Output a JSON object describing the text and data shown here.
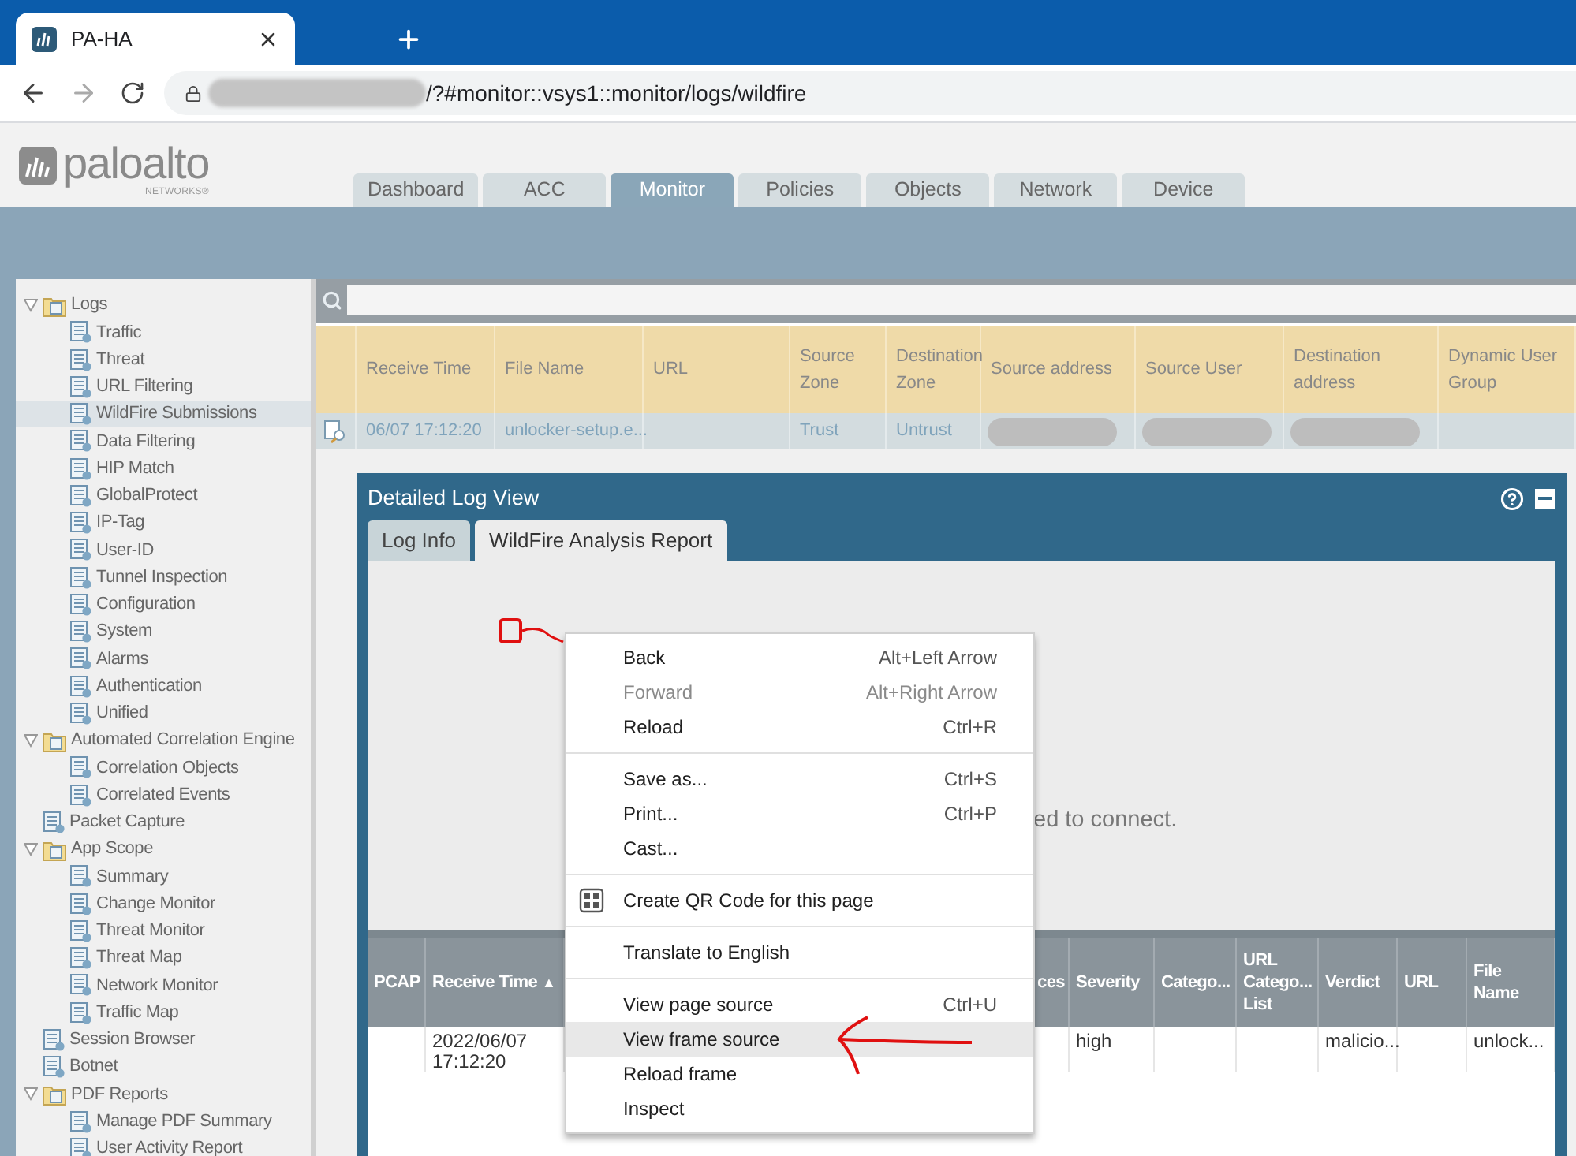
{
  "browser": {
    "tab": {
      "title": "PA-HA"
    },
    "address": {
      "url": "/?#monitor::vsys1::monitor/logs/wildfire",
      "redacted": true
    }
  },
  "header": {
    "logo": "paloalto",
    "logo_sub": "NETWORKS®",
    "tabs": [
      {
        "label": "Dashboard",
        "selected": false
      },
      {
        "label": "ACC",
        "selected": false
      },
      {
        "label": "Monitor",
        "selected": true
      },
      {
        "label": "Policies",
        "selected": false
      },
      {
        "label": "Objects",
        "selected": false
      },
      {
        "label": "Network",
        "selected": false
      },
      {
        "label": "Device",
        "selected": false
      }
    ]
  },
  "sidebar": {
    "items": [
      {
        "label": "Logs",
        "selected": false,
        "expanded": true,
        "children": [
          {
            "label": "Traffic",
            "selected": false
          },
          {
            "label": "Threat",
            "selected": false
          },
          {
            "label": "URL Filtering",
            "selected": false
          },
          {
            "label": "WildFire Submissions",
            "selected": true
          },
          {
            "label": "Data Filtering",
            "selected": false
          },
          {
            "label": "HIP Match",
            "selected": false
          },
          {
            "label": "GlobalProtect",
            "selected": false
          },
          {
            "label": "IP-Tag",
            "selected": false
          },
          {
            "label": "User-ID",
            "selected": false
          },
          {
            "label": "Tunnel Inspection",
            "selected": false
          },
          {
            "label": "Configuration",
            "selected": false
          },
          {
            "label": "System",
            "selected": false
          },
          {
            "label": "Alarms",
            "selected": false
          },
          {
            "label": "Authentication",
            "selected": false
          },
          {
            "label": "Unified",
            "selected": false
          }
        ]
      },
      {
        "label": "Automated Correlation Engine",
        "selected": false,
        "expanded": true,
        "children": [
          {
            "label": "Correlation Objects",
            "selected": false
          },
          {
            "label": "Correlated Events",
            "selected": false
          }
        ]
      },
      {
        "label": "Packet Capture",
        "selected": false
      },
      {
        "label": "App Scope",
        "selected": false,
        "expanded": true,
        "children": [
          {
            "label": "Summary",
            "selected": false
          },
          {
            "label": "Change Monitor",
            "selected": false
          },
          {
            "label": "Threat Monitor",
            "selected": false
          },
          {
            "label": "Threat Map",
            "selected": false
          },
          {
            "label": "Network Monitor",
            "selected": false
          },
          {
            "label": "Traffic Map",
            "selected": false
          }
        ]
      },
      {
        "label": "Session Browser",
        "selected": false
      },
      {
        "label": "Botnet",
        "selected": false
      },
      {
        "label": "PDF Reports",
        "selected": false,
        "expanded": true,
        "children": [
          {
            "label": "Manage PDF Summary",
            "selected": false
          },
          {
            "label": "User Activity Report",
            "selected": false
          }
        ]
      }
    ]
  },
  "log_table": {
    "columns": [
      "Receive Time",
      "File Name",
      "URL",
      "Source Zone",
      "Destination Zone",
      "Source address",
      "Source User",
      "Destination address",
      "Dynamic User Group"
    ],
    "rows": [
      {
        "cells": [
          "06/07 17:12:20",
          "unlocker-setup.e...",
          null,
          "Trust",
          "Untrust",
          {
            "redacted": true
          },
          {
            "redacted": true
          },
          {
            "redacted": true
          },
          null
        ]
      }
    ]
  },
  "detail_panel": {
    "title": "Detailed Log View",
    "tabs": [
      {
        "label": "Log Info",
        "selected": false
      },
      {
        "label": "WildFire Analysis Report",
        "selected": true
      }
    ],
    "message": "ed to connect.",
    "table": {
      "columns": [
        {
          "label": "PCAP"
        },
        {
          "label": "Receive Time",
          "sort_mark": "▲"
        },
        {
          "label": "ces"
        },
        {
          "label": "Severity"
        },
        {
          "label": "Catego..."
        },
        {
          "label": "URL Catego... List"
        },
        {
          "label": "Verdict"
        },
        {
          "label": "URL"
        },
        {
          "label": "File Name"
        }
      ],
      "rows": [
        {
          "cells": [
            null,
            "2022/06/07 17:12:20",
            null,
            "high",
            null,
            null,
            "malicio...",
            null,
            "unlock..."
          ]
        }
      ]
    }
  },
  "context_menu": {
    "items": [
      {
        "kind": "item",
        "label": "Back",
        "shortcut": "Alt+Left Arrow",
        "disabled": false,
        "selected": false
      },
      {
        "kind": "item",
        "label": "Forward",
        "shortcut": "Alt+Right Arrow",
        "disabled": true,
        "selected": false
      },
      {
        "kind": "item",
        "label": "Reload",
        "shortcut": "Ctrl+R",
        "disabled": false,
        "selected": false
      },
      {
        "kind": "separator"
      },
      {
        "kind": "item",
        "label": "Save as...",
        "shortcut": "Ctrl+S",
        "disabled": false,
        "selected": false
      },
      {
        "kind": "item",
        "label": "Print...",
        "shortcut": "Ctrl+P",
        "disabled": false,
        "selected": false
      },
      {
        "kind": "item",
        "label": "Cast...",
        "disabled": false,
        "selected": false
      },
      {
        "kind": "separator"
      },
      {
        "kind": "qr",
        "label": "Create QR Code for this page",
        "disabled": false,
        "selected": false
      },
      {
        "kind": "separator"
      },
      {
        "kind": "item",
        "label": "Translate to English",
        "disabled": false,
        "selected": false
      },
      {
        "kind": "separator"
      },
      {
        "kind": "item",
        "label": "View page source",
        "shortcut": "Ctrl+U",
        "disabled": false,
        "selected": false
      },
      {
        "kind": "item",
        "label": "View frame source",
        "disabled": false,
        "selected": true
      },
      {
        "kind": "item",
        "label": "Reload frame",
        "disabled": false,
        "selected": false
      },
      {
        "kind": "item",
        "label": "Inspect",
        "disabled": false,
        "selected": false
      }
    ]
  }
}
